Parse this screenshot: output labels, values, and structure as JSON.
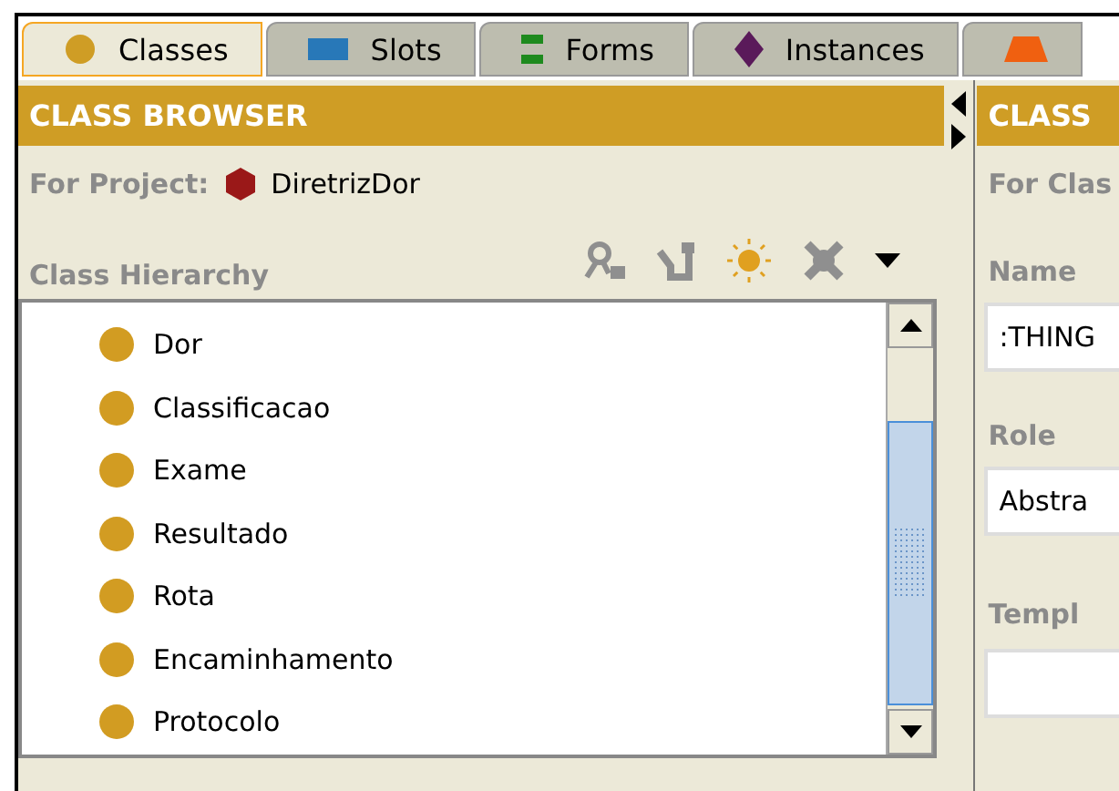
{
  "tabs": [
    {
      "label": "Classes",
      "kind": "circle",
      "selected": true
    },
    {
      "label": "Slots",
      "kind": "rect",
      "selected": false
    },
    {
      "label": "Forms",
      "kind": "bars",
      "selected": false
    },
    {
      "label": "Instances",
      "kind": "diamond",
      "selected": false
    },
    {
      "kind": "triangle",
      "selected": false
    }
  ],
  "class_browser": {
    "title": "CLASS BROWSER",
    "project_label": "For Project:",
    "project_name": "DiretrizDor",
    "hierarchy_label": "Class Hierarchy",
    "toolbar": [
      {
        "kind": "person",
        "disabled": true
      },
      {
        "kind": "link",
        "disabled": true
      },
      {
        "kind": "sun",
        "disabled": false
      },
      {
        "kind": "cross",
        "disabled": true
      },
      {
        "kind": "menu",
        "disabled": false
      }
    ],
    "classes": [
      {
        "name": "Dor"
      },
      {
        "name": "Classificacao"
      },
      {
        "name": "Exame"
      },
      {
        "name": "Resultado"
      },
      {
        "name": "Rota"
      },
      {
        "name": "Encaminhamento"
      },
      {
        "name": "Protocolo"
      }
    ]
  },
  "class_editor": {
    "title": "CLASS",
    "for_label": "For Clas",
    "name_label": "Name",
    "name_value": ":THING",
    "role_label": "Role",
    "role_value": "Abstra",
    "template_label": "Templ"
  }
}
